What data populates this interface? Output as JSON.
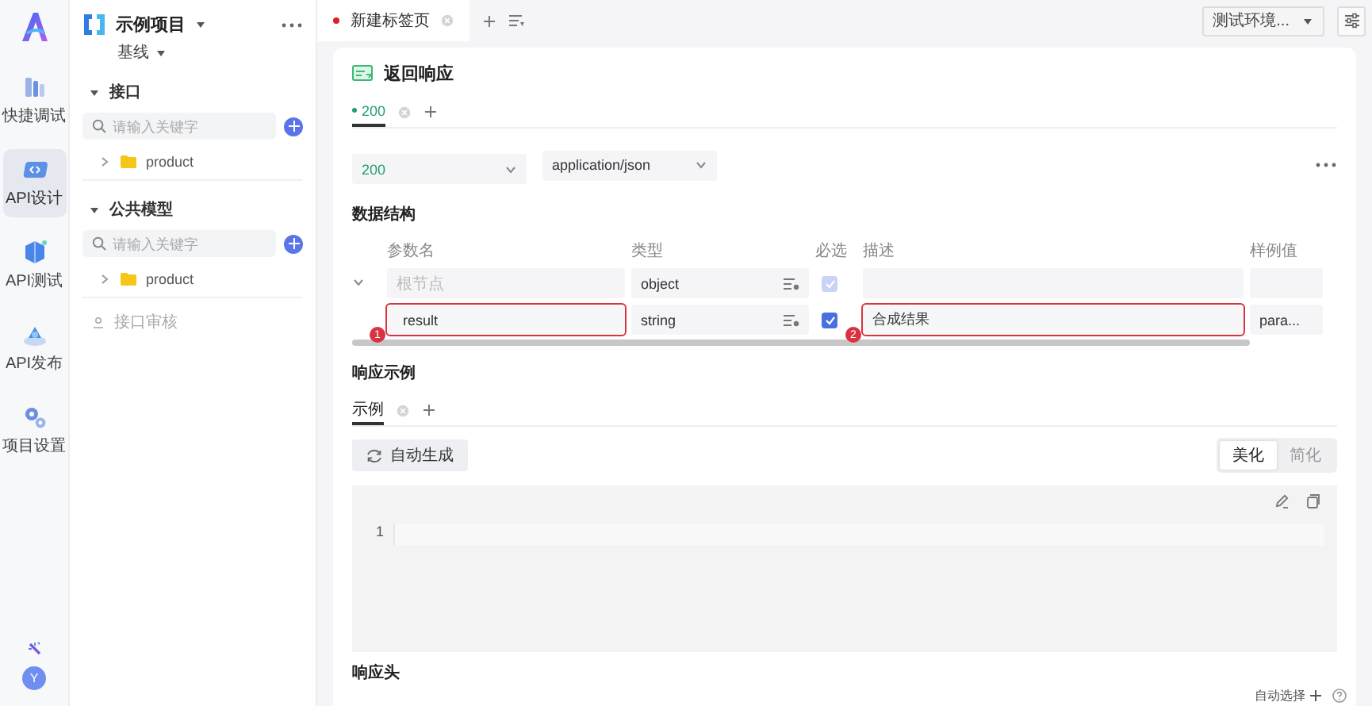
{
  "rail": {
    "items": [
      {
        "label": "快捷调试",
        "selected": false
      },
      {
        "label": "API设计",
        "selected": true
      },
      {
        "label": "API测试",
        "selected": false
      },
      {
        "label": "API发布",
        "selected": false
      },
      {
        "label": "项目设置",
        "selected": false
      }
    ],
    "avatar": "Y"
  },
  "project": {
    "name": "示例项目",
    "branch": "基线"
  },
  "sidebar": {
    "sections": [
      {
        "title": "接口",
        "expanded": true,
        "search": {
          "placeholder": "请输入关键字"
        },
        "items": [
          {
            "label": "product",
            "expanded": false
          }
        ]
      },
      {
        "title": "公共模型",
        "expanded": true,
        "search": {
          "placeholder": "请输入关键字"
        },
        "items": [
          {
            "label": "product",
            "expanded": false
          }
        ]
      }
    ],
    "footer": "接口审核"
  },
  "tabs": [
    {
      "label": "新建标签页",
      "selected": true,
      "modified": true
    }
  ],
  "environment": "测试环境...",
  "panel": {
    "title": "返回响应",
    "status_tabs": [
      {
        "label": "200",
        "selected": true
      }
    ],
    "status_code": "200",
    "content_type": "application/json",
    "structure_title": "数据结构",
    "columns": [
      "参数名",
      "类型",
      "必选",
      "描述",
      "样例值"
    ],
    "rows": [
      {
        "name_placeholder": "根节点",
        "type": "object",
        "required": true,
        "disabled": true,
        "highlighted": false,
        "expanded": true
      },
      {
        "name": "result",
        "type": "string",
        "required": true,
        "disabled": false,
        "highlighted": true,
        "description": "合成结果",
        "example": "para...",
        "name_marker": "1",
        "description_marker": "2"
      }
    ],
    "example_title": "响应示例",
    "example_tabs": [
      {
        "label": "示例",
        "selected": true
      }
    ],
    "generate_button": "自动生成",
    "format_options": [
      {
        "label": "美化",
        "selected": true
      },
      {
        "label": "简化",
        "selected": false
      }
    ],
    "line_numbers": [
      "1"
    ],
    "headers_title": "响应头"
  },
  "status_bar": {
    "auto_select": "自动选择"
  }
}
